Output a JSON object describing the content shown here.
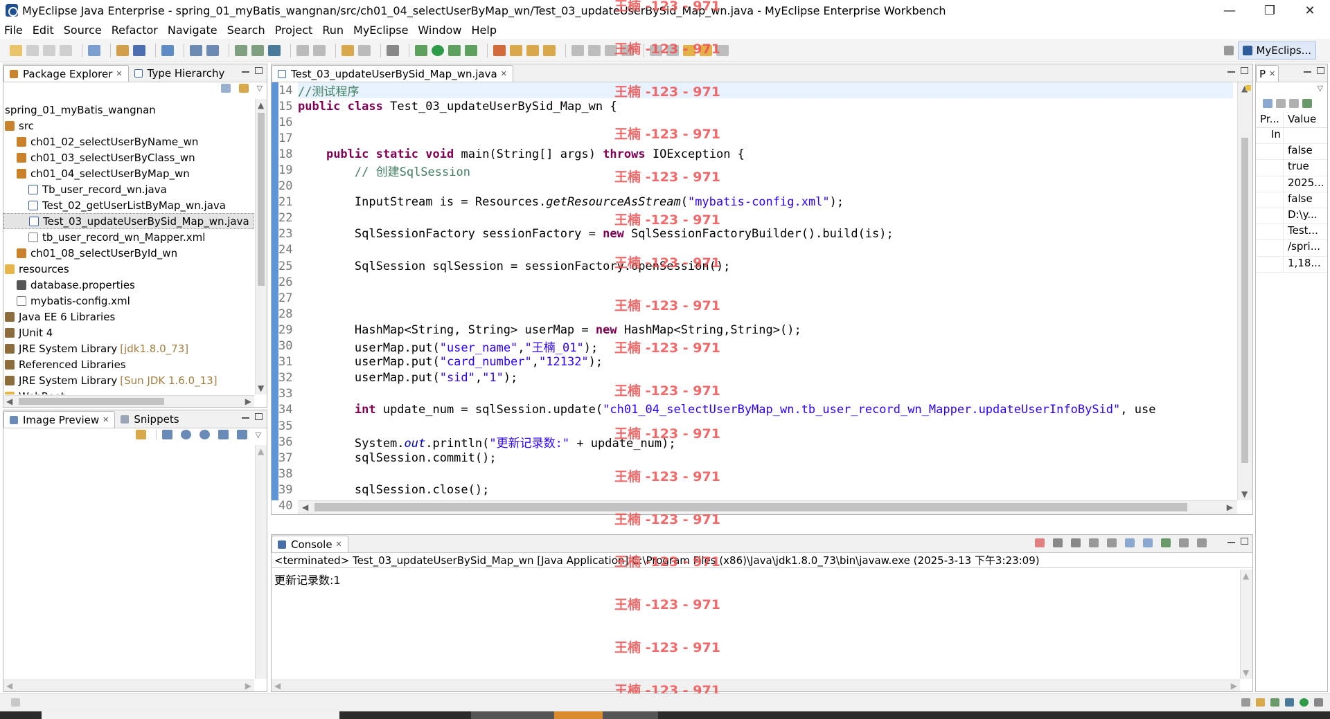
{
  "window": {
    "title": "MyEclipse Java Enterprise - spring_01_myBatis_wangnan/src/ch01_04_selectUserByMap_wn/Test_03_updateUserBySid_Map_wn.java - MyEclipse Enterprise Workbench",
    "minimize": "—",
    "restore": "❐",
    "close": "✕"
  },
  "menu": [
    "File",
    "Edit",
    "Source",
    "Refactor",
    "Navigate",
    "Search",
    "Project",
    "Run",
    "MyEclipse",
    "Window",
    "Help"
  ],
  "perspective": {
    "label": "MyEclips..."
  },
  "explorer": {
    "tabs": [
      "Package Explorer",
      "Type Hierarchy"
    ],
    "close_glyph": "✕",
    "tree": [
      {
        "label": "spring_01_myBatis_wangnan",
        "icon": "project-icon",
        "indent": 0
      },
      {
        "label": "src",
        "icon": "source-folder-icon",
        "indent": 0
      },
      {
        "label": "ch01_02_selectUserByName_wn",
        "icon": "package-icon",
        "indent": 1
      },
      {
        "label": "ch01_03_selectUserByClass_wn",
        "icon": "package-icon",
        "indent": 1
      },
      {
        "label": "ch01_04_selectUserByMap_wn",
        "icon": "package-icon",
        "indent": 1
      },
      {
        "label": "Tb_user_record_wn.java",
        "icon": "java-file-icon",
        "indent": 2
      },
      {
        "label": "Test_02_getUserListByMap_wn.java",
        "icon": "java-file-icon",
        "indent": 2
      },
      {
        "label": "Test_03_updateUserBySid_Map_wn.java",
        "icon": "java-file-icon",
        "indent": 2,
        "selected": true
      },
      {
        "label": "tb_user_record_wn_Mapper.xml",
        "icon": "xml-file-icon",
        "indent": 2
      },
      {
        "label": "ch01_08_selectUserById_wn",
        "icon": "package-icon",
        "indent": 1
      },
      {
        "label": "resources",
        "icon": "folder-icon",
        "indent": 0
      },
      {
        "label": "database.properties",
        "icon": "properties-file-icon",
        "indent": 1
      },
      {
        "label": "mybatis-config.xml",
        "icon": "xml-file-icon",
        "indent": 1
      },
      {
        "label": "Java EE 6 Libraries",
        "icon": "library-icon",
        "indent": 0
      },
      {
        "label": "JUnit 4",
        "icon": "library-icon",
        "indent": 0
      },
      {
        "label": "JRE System Library",
        "deco": "[jdk1.8.0_73]",
        "icon": "library-icon",
        "indent": 0
      },
      {
        "label": "Referenced Libraries",
        "icon": "library-icon",
        "indent": 0
      },
      {
        "label": "JRE System Library",
        "deco": "[Sun JDK 1.6.0_13]",
        "icon": "library-icon",
        "indent": 0
      },
      {
        "label": "WebRoot",
        "icon": "folder-icon",
        "indent": 0
      }
    ]
  },
  "preview": {
    "tabs": [
      "Image Preview",
      "Snippets"
    ]
  },
  "editor": {
    "tab": "Test_03_updateUserBySid_Map_wn.java",
    "lines": [
      {
        "n": "14",
        "html": "<span class=\"cm\">//测试程序</span>",
        "cur": true
      },
      {
        "n": "15",
        "html": "<span class=\"kw\">public</span> <span class=\"kw\">class</span> Test_03_updateUserBySid_Map_wn {"
      },
      {
        "n": "16",
        "html": ""
      },
      {
        "n": "17",
        "html": ""
      },
      {
        "n": "18",
        "html": "    <span class=\"kw\">public</span> <span class=\"kw\">static</span> <span class=\"kw\">void</span> main(String[] args) <span class=\"kw\">throws</span> IOException {"
      },
      {
        "n": "19",
        "html": "        <span class=\"cm\">// 创建SqlSession</span>"
      },
      {
        "n": "20",
        "html": ""
      },
      {
        "n": "21",
        "html": "        InputStream is = Resources.<span class=\"it\">getResourceAsStream</span>(<span class=\"str\">\"mybatis-config.xml\"</span>);"
      },
      {
        "n": "22",
        "html": ""
      },
      {
        "n": "23",
        "html": "        SqlSessionFactory sessionFactory = <span class=\"kw\">new</span> SqlSessionFactoryBuilder().build(is);"
      },
      {
        "n": "24",
        "html": ""
      },
      {
        "n": "25",
        "html": "        SqlSession sqlSession = sessionFactory.openSession();"
      },
      {
        "n": "26",
        "html": ""
      },
      {
        "n": "27",
        "html": ""
      },
      {
        "n": "28",
        "html": ""
      },
      {
        "n": "29",
        "html": "        HashMap&lt;String, String&gt; userMap = <span class=\"kw\">new</span> HashMap&lt;String,String&gt;();"
      },
      {
        "n": "30",
        "html": "        userMap.put(<span class=\"str\">\"user_name\"</span>,<span class=\"str\">\"王楠_01\"</span>);"
      },
      {
        "n": "31",
        "html": "        userMap.put(<span class=\"str\">\"card_number\"</span>,<span class=\"str\">\"12132\"</span>);"
      },
      {
        "n": "32",
        "html": "        userMap.put(<span class=\"str\">\"sid\"</span>,<span class=\"str\">\"1\"</span>);"
      },
      {
        "n": "33",
        "html": ""
      },
      {
        "n": "34",
        "html": "        <span class=\"kw\">int</span> update_num = sqlSession.update(<span class=\"str\">\"ch01_04_selectUserByMap_wn.tb_user_record_wn_Mapper.updateUserInfoBySid\"</span>, use"
      },
      {
        "n": "35",
        "html": ""
      },
      {
        "n": "36",
        "html": "        System.<span class=\"fld\">out</span>.println(<span class=\"str\">\"更新记录数:\"</span> + update_num);"
      },
      {
        "n": "37",
        "html": "        sqlSession.commit();"
      },
      {
        "n": "38",
        "html": ""
      },
      {
        "n": "39",
        "html": "        sqlSession.close();"
      },
      {
        "n": "40",
        "html": "    }"
      }
    ]
  },
  "console": {
    "tab": "Console",
    "header": "<terminated> Test_03_updateUserBySid_Map_wn [Java Application] C:\\Program Files (x86)\\Java\\jdk1.8.0_73\\bin\\javaw.exe (2025-3-13 下午3:23:09)",
    "output": "更新记录数:1"
  },
  "properties": {
    "tab": "P",
    "col_property": "Pr...",
    "col_value": "Value",
    "group": "In",
    "values": [
      "false",
      "true",
      "2025...",
      "false",
      "D:\\y...",
      "Test...",
      "/spri...",
      "1,18..."
    ]
  },
  "watermark": {
    "text": "王楠 -123 - 971"
  },
  "colors": {
    "keyword": "#7f0055",
    "string": "#2a00ff",
    "comment": "#3f7f5f",
    "watermark": "#ef5050",
    "change-ruler": "#5f95d3"
  }
}
